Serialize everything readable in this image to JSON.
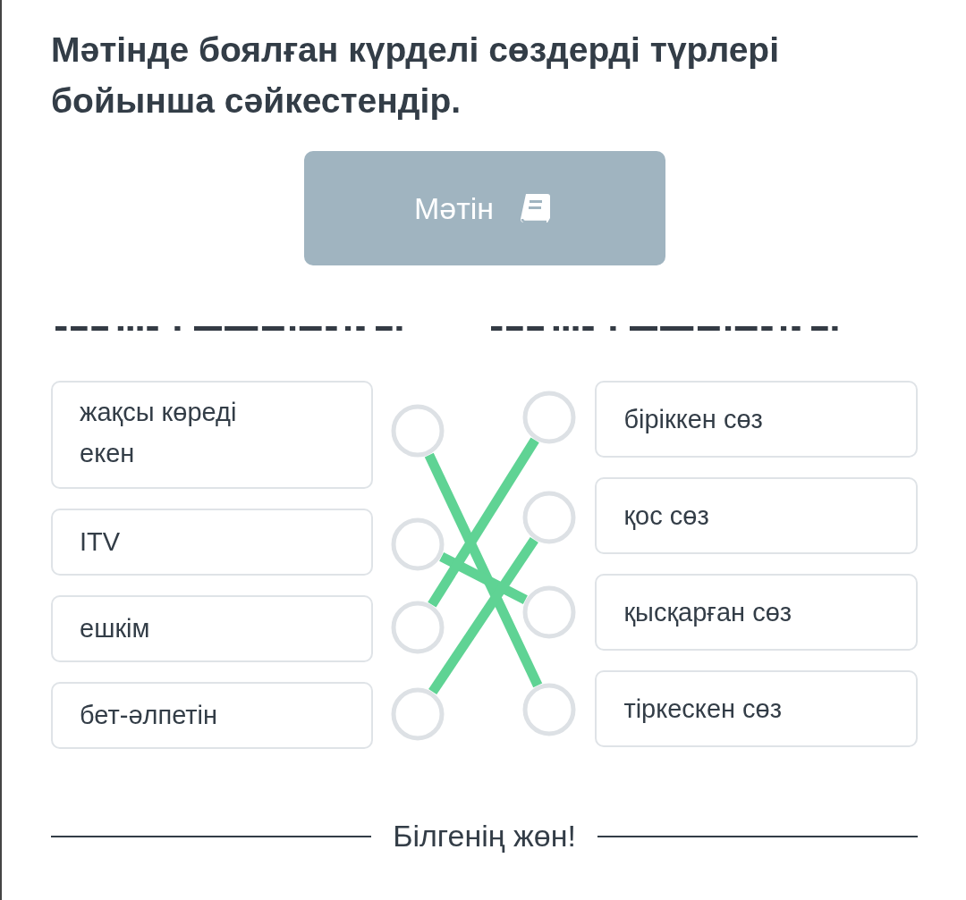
{
  "title": "Мәтінде боялған күрделі сөздерді түрлері бойынша сәйкестендір.",
  "text_button": {
    "label": "Мәтін"
  },
  "left_items": [
    {
      "text": "жақсы көреді екен",
      "connected": true
    },
    {
      "text": "ITV",
      "connected": true
    },
    {
      "text": "ешкім",
      "connected": true
    },
    {
      "text": "бет-әлпетін",
      "connected": true
    }
  ],
  "right_items": [
    {
      "text": "біріккен сөз"
    },
    {
      "text": "қос сөз"
    },
    {
      "text": "қысқарған сөз"
    },
    {
      "text": "тіркескен сөз"
    }
  ],
  "footer": "Білгенің жөн!"
}
